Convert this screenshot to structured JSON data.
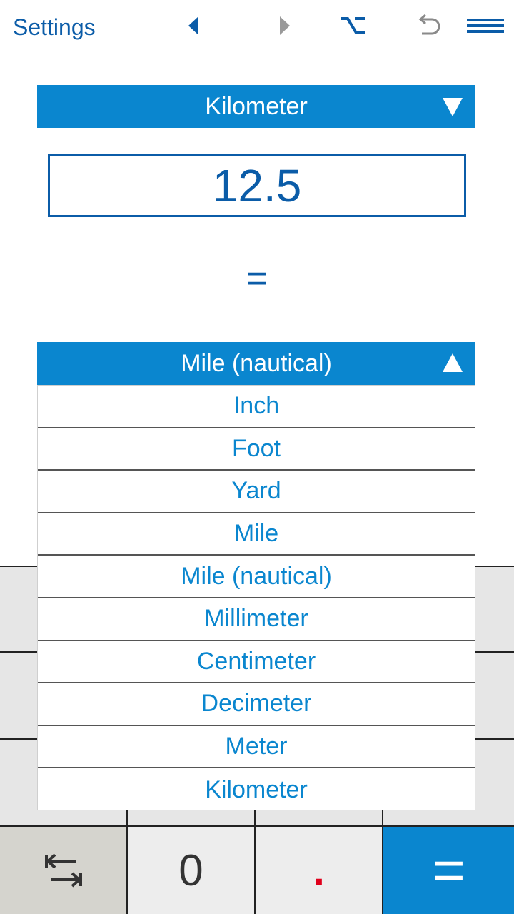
{
  "toolbar": {
    "settings_label": "Settings",
    "icons": [
      "back-arrow-icon",
      "forward-arrow-icon",
      "option-key-icon",
      "undo-icon",
      "menu-icon"
    ]
  },
  "converter": {
    "from_unit": "Kilometer",
    "input_value": "12.5",
    "equals": "=",
    "to_unit": "Mile (nautical)"
  },
  "dropdown": {
    "options": [
      "Inch",
      "Foot",
      "Yard",
      "Mile",
      "Mile (nautical)",
      "Millimeter",
      "Centimeter",
      "Decimeter",
      "Meter",
      "Kilometer"
    ]
  },
  "keypad": {
    "zero": "0",
    "decimal": ".",
    "equals": "=",
    "swap_icon": "swap-icon"
  },
  "colors": {
    "accent": "#0a86cf",
    "text_blue": "#0b5ca8",
    "key_gray": "#e6e6e6",
    "decimal_red": "#e0001b"
  }
}
